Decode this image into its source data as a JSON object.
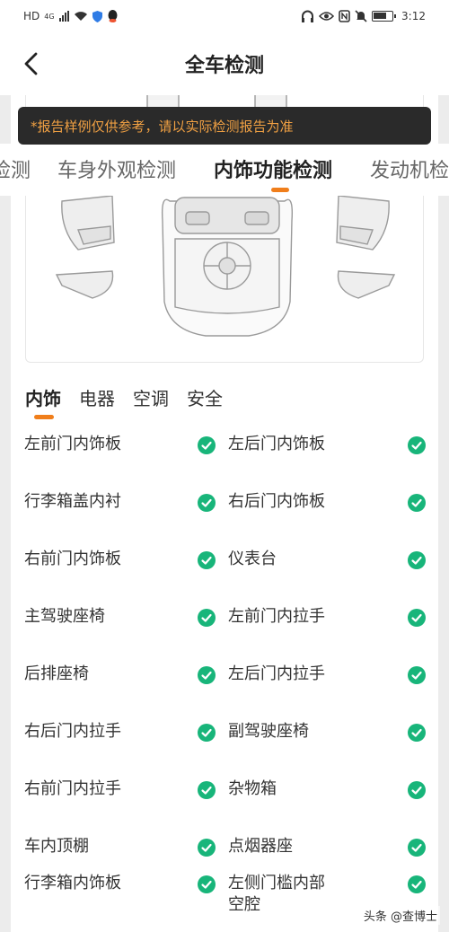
{
  "status_bar": {
    "network": "HD",
    "network_sup": "4G",
    "time": "3:12"
  },
  "header": {
    "title": "全车检测"
  },
  "notice": "*报告样例仅供参考，请以实际检测报告为准",
  "category_tabs": [
    "检测",
    "车身外观检测",
    "内饰功能检测",
    "发动机检测"
  ],
  "active_category": "内饰功能检测",
  "sub_tabs": [
    "内饰",
    "电器",
    "空调",
    "安全"
  ],
  "active_sub_tab": "内饰",
  "items": [
    {
      "name": "左前门内饰板",
      "status": "pass"
    },
    {
      "name": "左后门内饰板",
      "status": "pass"
    },
    {
      "name": "行李箱盖内衬",
      "status": "pass"
    },
    {
      "name": "右后门内饰板",
      "status": "pass"
    },
    {
      "name": "右前门内饰板",
      "status": "pass"
    },
    {
      "name": "仪表台",
      "status": "pass"
    },
    {
      "name": "主驾驶座椅",
      "status": "pass"
    },
    {
      "name": "左前门内拉手",
      "status": "pass"
    },
    {
      "name": "后排座椅",
      "status": "pass"
    },
    {
      "name": "左后门内拉手",
      "status": "pass"
    },
    {
      "name": "右后门内拉手",
      "status": "pass"
    },
    {
      "name": "副驾驶座椅",
      "status": "pass"
    },
    {
      "name": "右前门内拉手",
      "status": "pass"
    },
    {
      "name": "杂物箱",
      "status": "pass"
    },
    {
      "name": "车内顶棚",
      "status": "pass"
    },
    {
      "name": "点烟器座",
      "status": "pass"
    },
    {
      "name": "行李箱内饰板",
      "status": "pass"
    },
    {
      "name": "左侧门槛内部空腔",
      "status": "pass"
    }
  ],
  "watermark": "头条 @查博士",
  "colors": {
    "accent": "#f07e1b",
    "check": "#18b57a",
    "notice_bg": "#2a2a2a",
    "notice_text": "#f0a043"
  }
}
